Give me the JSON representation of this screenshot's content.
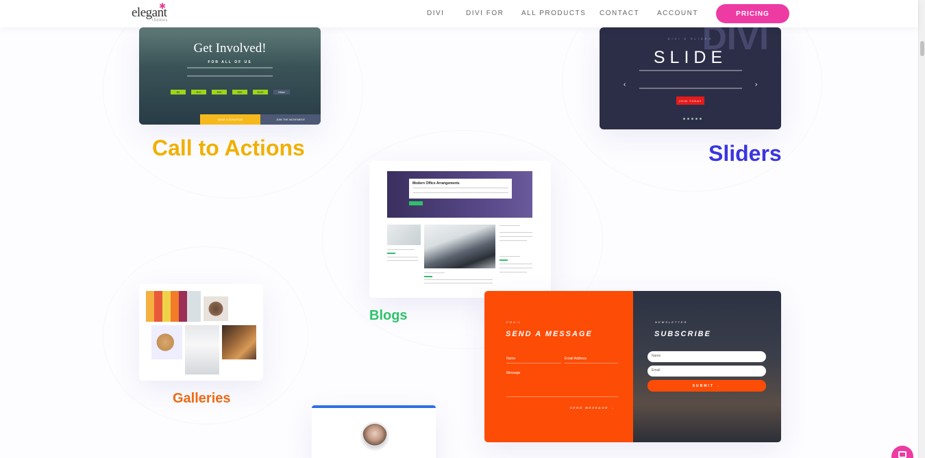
{
  "header": {
    "logo_main": "elegant",
    "logo_sub": "themes",
    "nav": [
      "DIVI",
      "DIVI FOR",
      "ALL PRODUCTS",
      "CONTACT",
      "ACCOUNT"
    ],
    "cta": "PRICING"
  },
  "cta_card": {
    "title": "Get Involved!",
    "subtitle": "FOR ALL OF US",
    "chips": [
      "$5",
      "$10",
      "$25",
      "$50",
      "$100",
      "Other"
    ],
    "button_left": "MAKE A DONATION",
    "button_right": "JOIN THE MOVEMENT",
    "label": "Call to Actions"
  },
  "slider_card": {
    "ghost": "DIVI",
    "kicker": "DIVI 5 SLIDER",
    "title": "SLIDE",
    "button": "JOIN TODAY",
    "label": "Sliders"
  },
  "blog_card": {
    "hero_title": "Modern Office Arrangements",
    "post_a": "Working from Home",
    "post_b": "Meet Your Clients",
    "post_c": "Meet Your Clients",
    "post_d": "Mental Endurance",
    "label": "Blogs"
  },
  "gallery_card": {
    "label": "Galleries"
  },
  "contact_card": {
    "left_kicker": "EMAIL",
    "left_title": "SEND A MESSAGE",
    "field_name": "Name",
    "field_email": "Email Address",
    "field_message": "Message",
    "send": "SEND MESSAGE →",
    "right_kicker": "NEWSLETTER",
    "right_title": "SUBSCRIBE",
    "input_name": "Name",
    "input_email": "Email",
    "subscribe": "SUBMIT →"
  },
  "colors": {
    "accent": "#ed3ba3",
    "cta_label": "#f0b000",
    "slider_label": "#3b35e0",
    "blog_label": "#2dc36a",
    "gallery_label": "#f06914",
    "contact_orange": "#fd4c06"
  }
}
